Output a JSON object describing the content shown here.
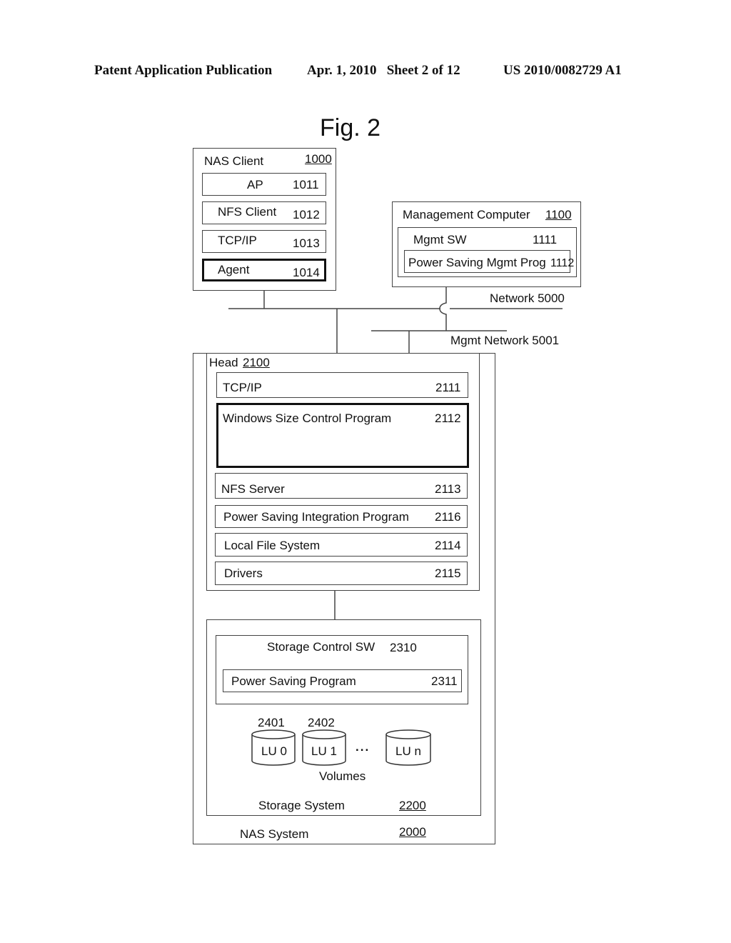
{
  "header": {
    "publication": "Patent Application Publication",
    "date_sheet": "Apr. 1, 2010   Sheet 2 of 12",
    "number": "US 2010/0082729 A1"
  },
  "figure_title": "Fig. 2",
  "nas_client": {
    "label": "NAS Client",
    "ref": "1000",
    "items": [
      {
        "label": "AP",
        "ref": "1011"
      },
      {
        "label": "NFS Client",
        "ref": "1012"
      },
      {
        "label": "TCP/IP",
        "ref": "1013"
      },
      {
        "label": "Agent",
        "ref": "1014",
        "emphasized": true
      }
    ]
  },
  "management_computer": {
    "label": "Management Computer",
    "ref": "1100",
    "mgmt_sw": {
      "label": "Mgmt SW",
      "ref": "1111"
    },
    "power_saving_mgmt": {
      "label": "Power Saving Mgmt Prog",
      "ref": "1112"
    }
  },
  "networks": {
    "network": "Network 5000",
    "mgmt_network": "Mgmt Network 5001"
  },
  "nas_system": {
    "label": "NAS System",
    "ref": "2000",
    "head": {
      "label": "Head",
      "ref": "2100",
      "items": [
        {
          "label": "TCP/IP",
          "ref": "2111"
        },
        {
          "label": "Windows Size Control Program",
          "ref": "2112",
          "emphasized": true
        },
        {
          "label": "NFS Server",
          "ref": "2113"
        },
        {
          "label": "Power Saving Integration Program",
          "ref": "2116"
        },
        {
          "label": "Local File System",
          "ref": "2114"
        },
        {
          "label": "Drivers",
          "ref": "2115"
        }
      ]
    },
    "storage_system": {
      "label": "Storage System",
      "ref": "2200",
      "control_sw": {
        "label": "Storage Control SW",
        "ref": "2310"
      },
      "power_saving_program": {
        "label": "Power Saving Program",
        "ref": "2311"
      },
      "volumes_label": "Volumes",
      "ellipsis": "...",
      "volumes": [
        {
          "label": "LU 0",
          "ref": "2401"
        },
        {
          "label": "LU 1",
          "ref": "2402"
        },
        {
          "label": "LU n",
          "ref": ""
        }
      ]
    }
  }
}
